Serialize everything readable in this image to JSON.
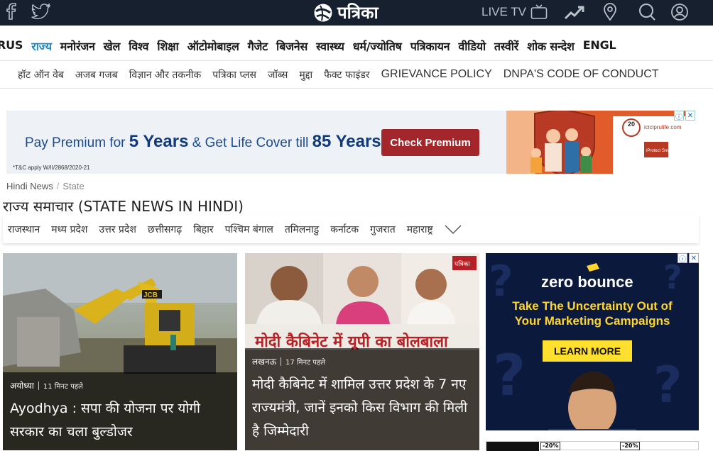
{
  "topbar": {
    "brand_name": "पत्रिका",
    "live_tv_label": "LIVE TV",
    "icons": [
      "facebook-icon",
      "twitter-icon",
      "tv-icon",
      "trending-icon",
      "location-icon",
      "search-icon",
      "user-icon"
    ]
  },
  "main_nav": {
    "items": [
      "RUS",
      "राज्य",
      "मनोरंजन",
      "खेल",
      "विश्व",
      "शिक्षा",
      "ऑटोमोबाइल",
      "गैजेट",
      "बिजनेस",
      "स्वास्थ्य",
      "धर्म/ज्योतिष",
      "पत्रिकायन",
      "वीडियो",
      "तस्वीरें",
      "शोक सन्देश",
      "ENGL"
    ],
    "active": "राज्य"
  },
  "sub_nav": {
    "items": [
      "हॉट ऑन वेब",
      "अजब गजब",
      "विज्ञान और तकनीक",
      "पत्रिका प्लस",
      "जॉब्स",
      "मुद्दा",
      "फैक्ट फाइंडर",
      "GRIEVANCE POLICY",
      "DNPA'S CODE OF CONDUCT"
    ]
  },
  "top_ad": {
    "text_prefix": "Pay Premium for",
    "years1": "5 Years",
    "text_mid": "& Get Life Cover till",
    "years2": "85 Years",
    "trademark": "¹",
    "button": "Check Premium",
    "tc": "*T&C apply W/II/2868/2020-21",
    "badge_num": "20",
    "site": "iciciprulife.com",
    "product": "iProtect Smart",
    "colors": {
      "text": "#1b4b8f",
      "button": "#a3262a",
      "art": "#e25b2a"
    }
  },
  "breadcrumb": {
    "home": "Hindi News",
    "sep": "/",
    "current": "State"
  },
  "page_title": "राज्य समाचार (STATE NEWS IN HINDI)",
  "state_tabs": [
    "राजस्थान",
    "मध्य प्रदेश",
    "उत्तर प्रदेश",
    "छत्तीसगढ़",
    "बिहार",
    "पश्चिम बंगाल",
    "तमिलनाडु",
    "कर्नाटक",
    "गुजरात",
    "महाराष्ट्र"
  ],
  "stories": [
    {
      "city": "अयोध्या",
      "time": "11 मिनट पहले",
      "headline_line1": "Ayodhya : सपा की योजना पर योगी",
      "headline_line2": "सरकार का चला बुल्डोजर",
      "image_text": "JCB"
    },
    {
      "city": "लखनऊ",
      "time": "17 मिनट पहले",
      "banner": "मोदी कैबिनेट में यूपी का बोलबाला",
      "image_logo": "पत्रिका",
      "headline_line1": "मोदी कैबिनेट में शामिल उत्तर प्रदेश के 7 नए",
      "headline_line2": "राज्यमंत्री, जानें इनको किस विभाग की मिली",
      "headline_line3": "है जिम्मेदारी"
    }
  ],
  "right_ad": {
    "brand": "zero bounce",
    "tagline1": "Take The Uncertainty Out of",
    "tagline2": "Your Marketing Campaigns",
    "cta": "LEARN MORE",
    "colors": {
      "bg": "#0b1a3c",
      "accent": "#ffd52e"
    }
  },
  "bottom_strip": {
    "pct1": "-20%",
    "pct2": "-20%"
  },
  "ad_choices": {
    "info": "ⓘ",
    "close": "✕"
  }
}
